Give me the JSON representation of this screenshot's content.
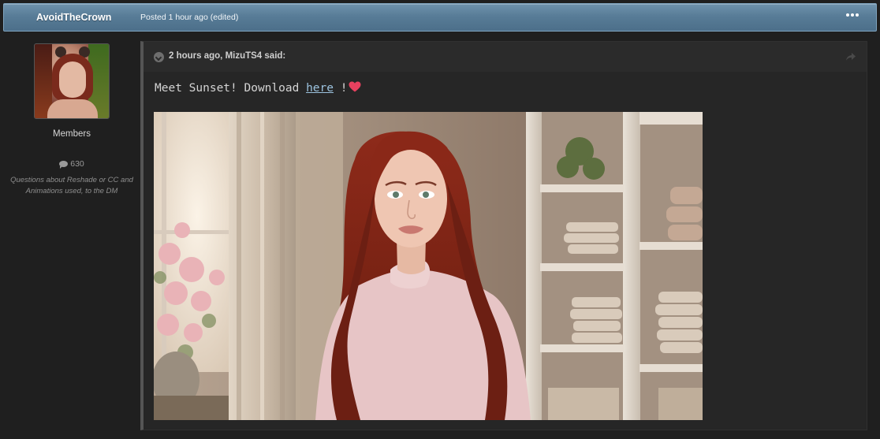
{
  "header": {
    "author": "AvoidTheCrown",
    "posted": "Posted 1 hour ago (edited)"
  },
  "author_panel": {
    "group": "Members",
    "post_count": "630",
    "signature": "Questions about Reshade or CC and Animations used, to the DM"
  },
  "quote": {
    "citation": "2 hours ago, MizuTS4 said:",
    "text_before": "Meet Sunset! Download ",
    "link_text": "here",
    "text_after": " !"
  },
  "icons": {
    "more": "ellipsis-icon",
    "comment": "comment-icon",
    "toggle": "chevron-circle-icon",
    "share": "share-icon",
    "heart": "heart-icon"
  },
  "colors": {
    "header_bar": "#587c97",
    "link": "#9cc3df",
    "heart": "#e8415f",
    "background": "#1f1f1f"
  }
}
